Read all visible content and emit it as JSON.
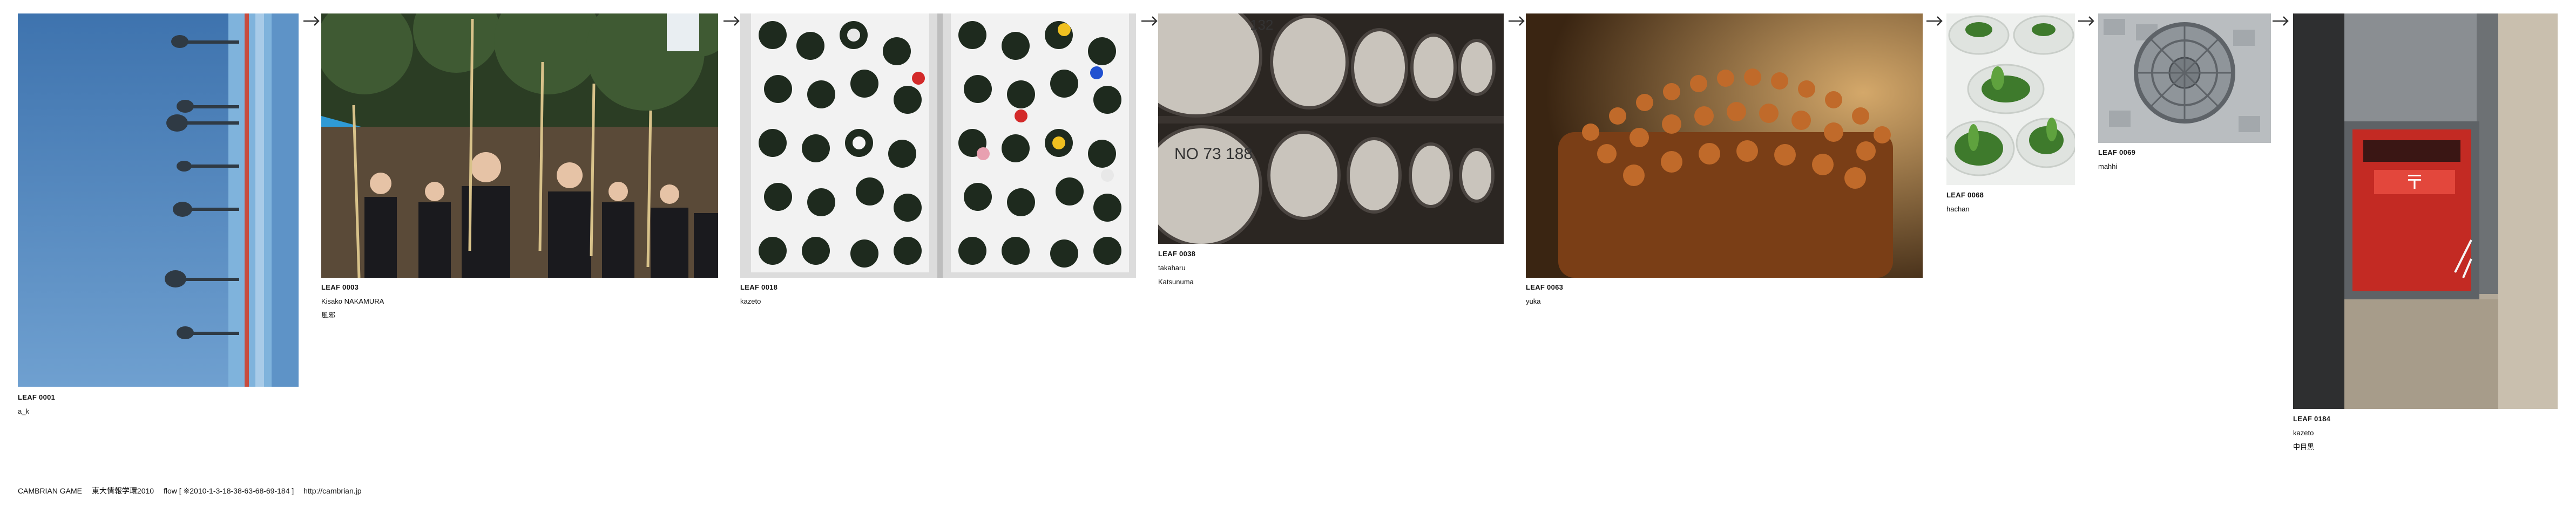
{
  "leaves": [
    {
      "id": "LEAF 0001",
      "author": "a_k"
    },
    {
      "id": "LEAF 0003",
      "author": "Kisako NAKAMURA",
      "note": "風邪"
    },
    {
      "id": "LEAF 0018",
      "author": "kazeto"
    },
    {
      "id": "LEAF 0038",
      "author": "takaharu",
      "note": "Katsunuma"
    },
    {
      "id": "LEAF 0063",
      "author": "yuka"
    },
    {
      "id": "LEAF 0068",
      "author": "hachan"
    },
    {
      "id": "LEAF 0069",
      "author": "mahhi"
    },
    {
      "id": "LEAF 0184",
      "author": "kazeto",
      "note": "中目黒"
    }
  ],
  "barrel_labels": {
    "top": "132",
    "left": "NO 73 188"
  },
  "arrow_glyph": "→",
  "footer": {
    "brand": "CAMBRIAN GAME",
    "course": "東大情報学環2010",
    "flow": "flow [ ※2010-1-3-18-38-63-68-69-184 ]",
    "url": "http://cambrian.jp"
  }
}
